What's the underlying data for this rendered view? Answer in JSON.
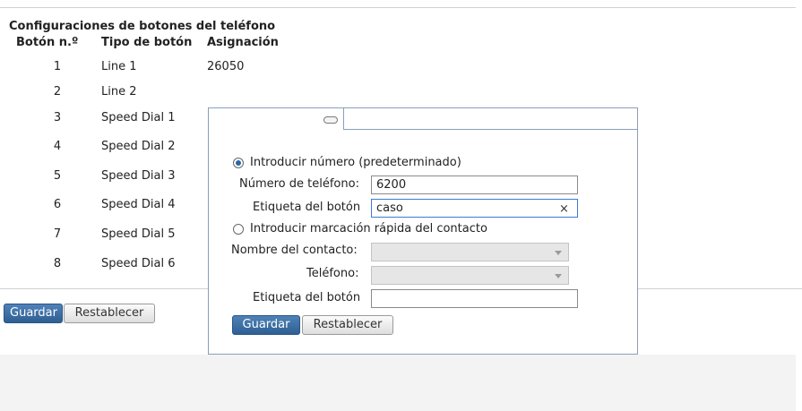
{
  "section_title": "Configuraciones de botones del teléfono",
  "table": {
    "headers": {
      "num": "Botón n.º",
      "type": "Tipo de botón",
      "assignment": "Asignación"
    },
    "rows": [
      {
        "num": "1",
        "type": "Line 1",
        "assignment": "26050"
      },
      {
        "num": "2",
        "type": "Line 2",
        "assignment": ""
      },
      {
        "num": "3",
        "type": "Speed Dial 1",
        "assignment": ""
      },
      {
        "num": "4",
        "type": "Speed Dial 2",
        "assignment": ""
      },
      {
        "num": "5",
        "type": "Speed Dial 3",
        "assignment": ""
      },
      {
        "num": "6",
        "type": "Speed Dial 4",
        "assignment": ""
      },
      {
        "num": "7",
        "type": "Speed Dial 5",
        "assignment": ""
      },
      {
        "num": "8",
        "type": "Speed Dial 6",
        "assignment": ""
      }
    ]
  },
  "page_buttons": {
    "save": "Guardar",
    "reset": "Restablecer"
  },
  "popup": {
    "option_number": "Introducir número (predeterminado)",
    "phone_label": "Número de teléfono:",
    "phone_value": "6200",
    "button_label_label": "Etiqueta del botón",
    "button_label_value": "caso",
    "clear_glyph": "×",
    "option_contact": "Introducir marcación rápida del contacto",
    "contact_name_label": "Nombre del contacto:",
    "contact_phone_label": "Teléfono:",
    "contact_button_label_label": "Etiqueta del botón",
    "save": "Guardar",
    "reset": "Restablecer"
  },
  "colors": {
    "primary_button": "#2e5f93",
    "popup_border": "#8a9fb8",
    "focus": "#3a7bd5"
  }
}
